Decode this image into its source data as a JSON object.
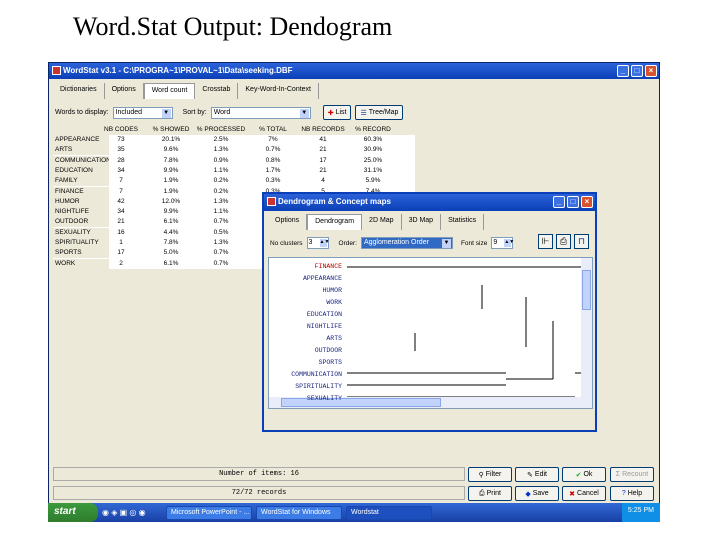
{
  "slide_title": "Word.Stat Output:  Dendogram",
  "window": {
    "title": "WordStat v3.1 - C:\\PROGRA~1\\PROVAL~1\\Data\\seeking.DBF",
    "tabs": [
      "Dictionaries",
      "Options",
      "Word count",
      "Crosstab",
      "Key-Word-In-Context"
    ],
    "words_label": "Words to display:",
    "words_value": "Included",
    "sort_label": "Sort by:",
    "sort_value": "Word",
    "list_button": "List",
    "treemap_button": "Tree/Map"
  },
  "table": {
    "headers": [
      "NB CODES",
      "% SHOWED",
      "% PROCESSED",
      "% TOTAL",
      "NB RECORDS",
      "% RECORD"
    ],
    "rows": [
      {
        "label": "APPEARANCE",
        "cells": [
          "73",
          "20.1%",
          "2.5%",
          "7%",
          "41",
          "60.3%"
        ]
      },
      {
        "label": "ARTS",
        "cells": [
          "35",
          "9.6%",
          "1.3%",
          "0.7%",
          "21",
          "30.9%"
        ]
      },
      {
        "label": "COMMUNICATION",
        "cells": [
          "28",
          "7.8%",
          "0.9%",
          "0.8%",
          "17",
          "25.0%"
        ]
      },
      {
        "label": "EDUCATION",
        "cells": [
          "34",
          "9.9%",
          "1.1%",
          "1.7%",
          "21",
          "31.1%"
        ]
      },
      {
        "label": "FAMILY",
        "cells": [
          "7",
          "1.9%",
          "0.2%",
          "0.3%",
          "4",
          "5.9%"
        ]
      },
      {
        "label": "FINANCE",
        "cells": [
          "7",
          "1.9%",
          "0.2%",
          "0.3%",
          "5",
          "7.4%"
        ]
      },
      {
        "label": "HUMOR",
        "cells": [
          "42",
          "12.0%",
          "1.3%",
          "",
          "",
          ""
        ]
      },
      {
        "label": "NIGHTLIFE",
        "cells": [
          "34",
          "9.9%",
          "1.1%",
          "",
          "",
          ""
        ]
      },
      {
        "label": "OUTDOOR",
        "cells": [
          "21",
          "6.1%",
          "0.7%",
          "",
          "",
          ""
        ]
      },
      {
        "label": "SEXUALITY",
        "cells": [
          "16",
          "4.4%",
          "0.5%",
          "",
          "",
          ""
        ]
      },
      {
        "label": "SPIRITUALITY",
        "cells": [
          "1",
          "7.8%",
          "1.3%",
          "",
          "",
          ""
        ]
      },
      {
        "label": "SPORTS",
        "cells": [
          "17",
          "5.0%",
          "0.7%",
          "",
          "",
          ""
        ]
      },
      {
        "label": "WORK",
        "cells": [
          "2",
          "6.1%",
          "0.7%",
          "",
          "",
          ""
        ]
      }
    ]
  },
  "dialog": {
    "title": "Dendrogram & Concept maps",
    "tabs": [
      "Options",
      "Dendrogram",
      "2D Map",
      "3D Map",
      "Statistics"
    ],
    "clusters_label": "No clusters",
    "clusters_value": "3",
    "order_label": "Order:",
    "order_value": "Agglomeration Order",
    "font_label": "Font size",
    "font_value": "9",
    "labels": [
      "FINANCE",
      "APPEARANCE",
      "HUMOR",
      "WORK",
      "EDUCATION",
      "NIGHTLIFE",
      "ARTS",
      "OUTDOOR",
      "SPORTS",
      "COMMUNICATION",
      "SPIRITUALITY",
      "SEXUALITY"
    ]
  },
  "status": {
    "items": "Number of items: 16",
    "records": "72/72 records"
  },
  "buttons": {
    "filter": "Filter",
    "edit": "Edit",
    "ok": "Ok",
    "recount": "Recount",
    "print": "Print",
    "save": "Save",
    "cancel": "Cancel",
    "help": "Help"
  },
  "taskbar": {
    "start": "start",
    "tasks": [
      "Microsoft PowerPoint - ...",
      "WordStat for Windows",
      "Wordstat"
    ],
    "clock": "5:25 PM"
  }
}
